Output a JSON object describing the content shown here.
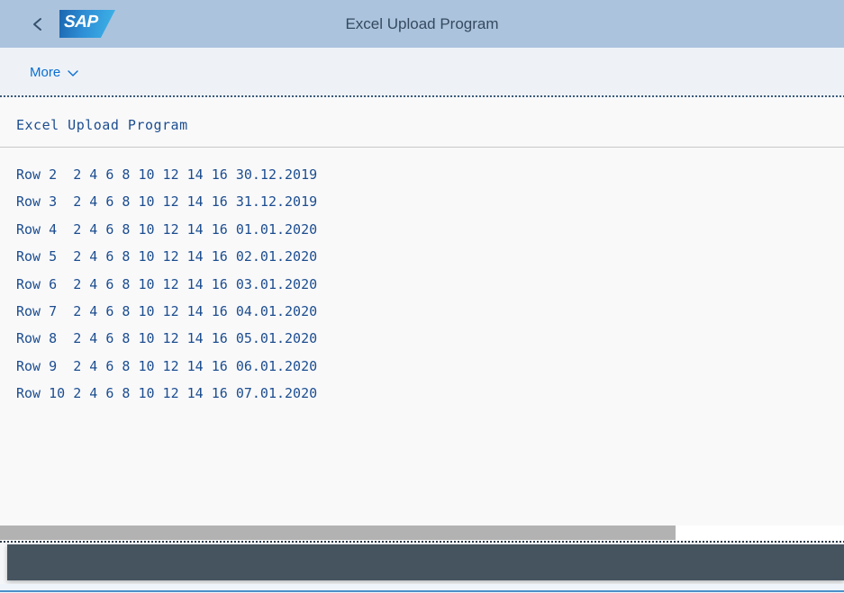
{
  "header": {
    "title": "Excel Upload Program",
    "back_icon": "chevron-left-icon",
    "logo_text": "SAP"
  },
  "toolbar": {
    "more_label": "More",
    "more_icon": "chevron-down-icon"
  },
  "report": {
    "heading": "Excel Upload Program",
    "lines": [
      "Row 2  2 4 6 8 10 12 14 16 30.12.2019",
      "Row 3  2 4 6 8 10 12 14 16 31.12.2019",
      "Row 4  2 4 6 8 10 12 14 16 01.01.2020",
      "Row 5  2 4 6 8 10 12 14 16 02.01.2020",
      "Row 6  2 4 6 8 10 12 14 16 03.01.2020",
      "Row 7  2 4 6 8 10 12 14 16 04.01.2020",
      "Row 8  2 4 6 8 10 12 14 16 05.01.2020",
      "Row 9  2 4 6 8 10 12 14 16 06.01.2020",
      "Row 10 2 4 6 8 10 12 14 16 07.01.2020"
    ]
  },
  "scrollbar": {
    "orientation": "horizontal",
    "thumb_fraction": 0.8
  },
  "colors": {
    "shell_header_bg": "#abc3dd",
    "toolbar_bg": "#eef2f7",
    "content_bg": "#f9f9fa",
    "report_text": "#1c4d8f",
    "accent_link": "#0a6ed1",
    "footer_bar": "#46545f",
    "scroll_thumb": "#b2b2b2",
    "bottom_line": "#4a90c8"
  }
}
